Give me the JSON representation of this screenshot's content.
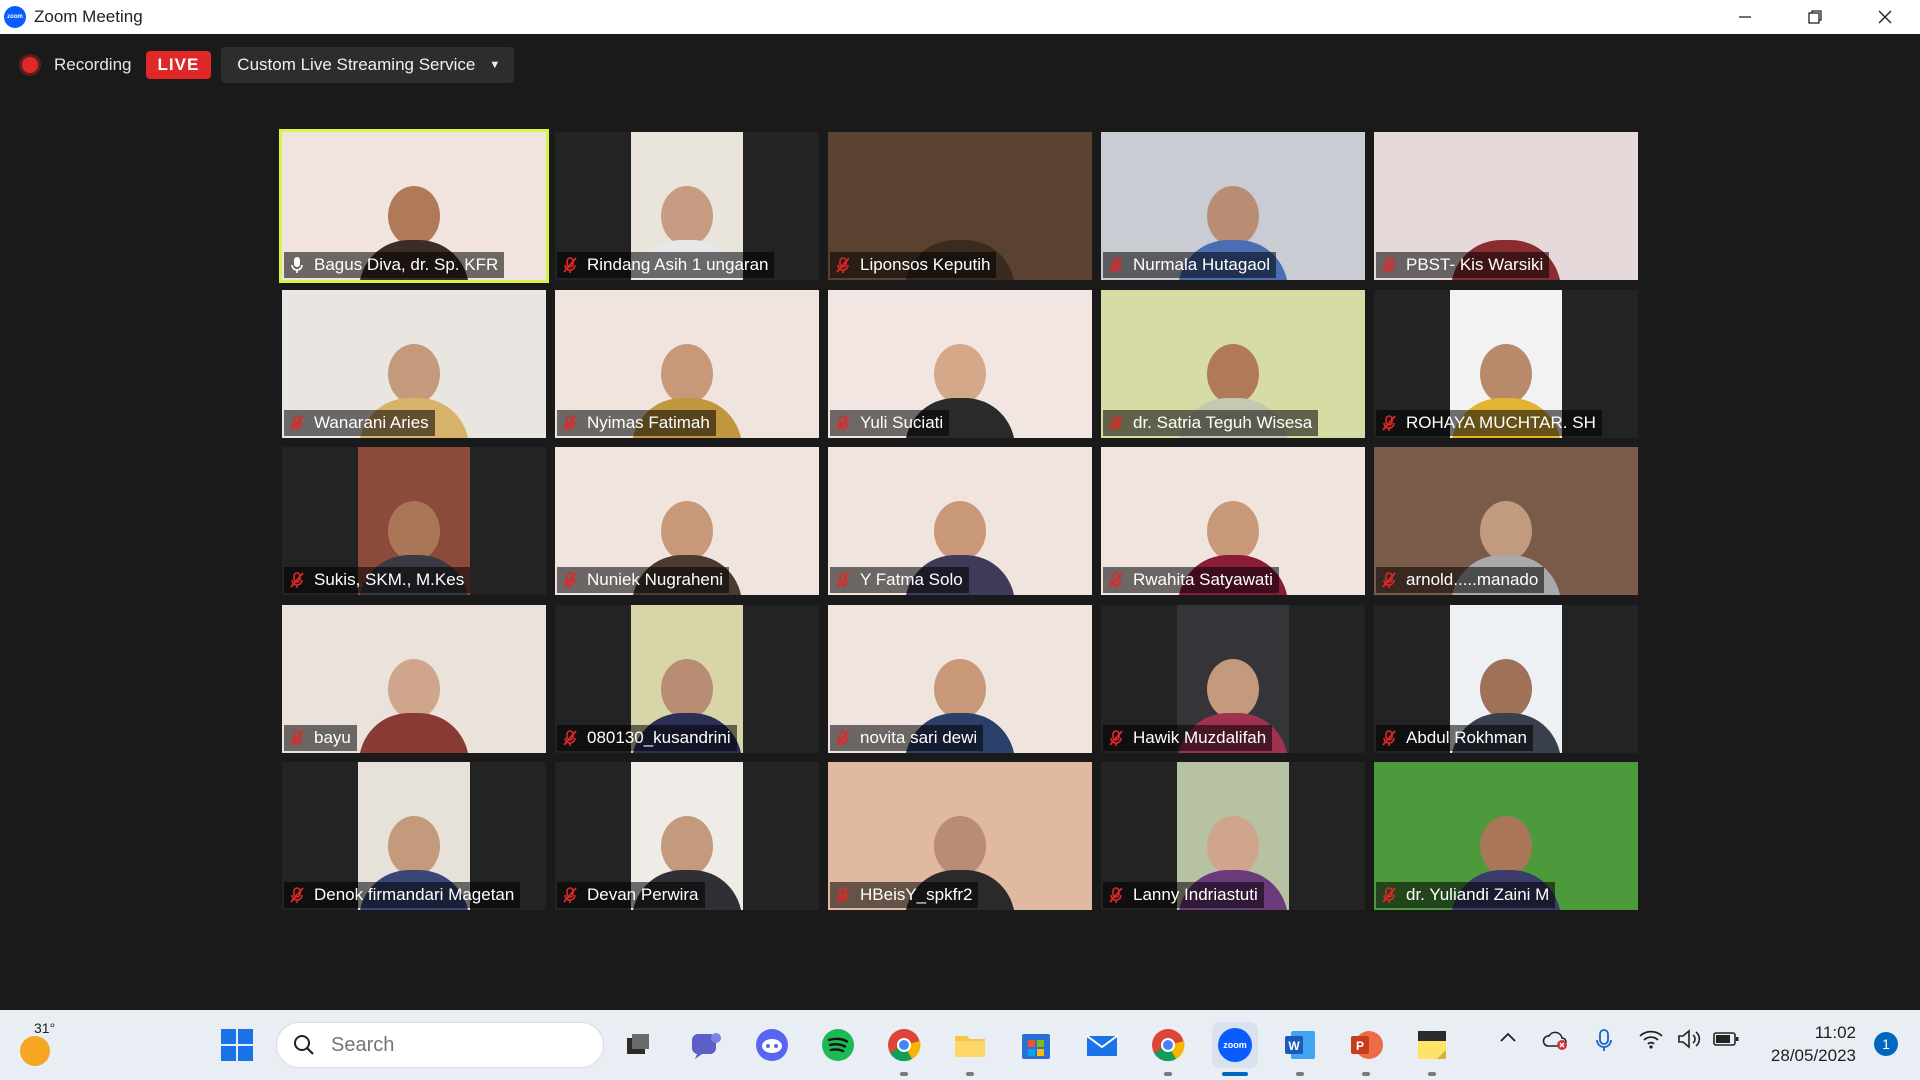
{
  "window": {
    "title": "Zoom Meeting",
    "minimize_icon": "minimize-icon",
    "restore_icon": "restore-icon",
    "close_icon": "close-icon"
  },
  "meeting_bar": {
    "recording_label": "Recording",
    "live_label": "LIVE",
    "stream_service": "Custom Live Streaming Service"
  },
  "colors": {
    "active_speaker": "#d9f34a",
    "live_red": "#e02828",
    "mic_muted": "#e02828"
  },
  "participants": [
    {
      "name": "Bagus Diva, dr. Sp. KFR",
      "mic": "active",
      "active": true,
      "layout": "full",
      "bg": "#f1e4de",
      "skin": "#b07a58",
      "cloth": "#3a2c28"
    },
    {
      "name": "Rindang Asih 1 ungaran",
      "mic": "muted",
      "layout": "narrow",
      "bg": "#e9e4dc",
      "skin": "#c69d83",
      "cloth": "#e8e8ea"
    },
    {
      "name": "Liponsos Keputih",
      "mic": "muted",
      "layout": "full",
      "bg": "#5b4230",
      "skin": "#5b4230",
      "cloth": "#3b2a1e"
    },
    {
      "name": "Nurmala Hutagaol",
      "mic": "muted",
      "layout": "full",
      "bg": "#c9ccd2",
      "skin": "#b88d73",
      "cloth": "#4a6db3"
    },
    {
      "name": "PBST- Kis Warsiki",
      "mic": "muted",
      "layout": "full",
      "bg": "#e6d9da",
      "skin": "#e6d9da",
      "cloth": "#8a2d32"
    },
    {
      "name": "Wanarani Aries",
      "mic": "muted",
      "layout": "full",
      "bg": "#e9e6e2",
      "skin": "#c49a7d",
      "cloth": "#d8b26a"
    },
    {
      "name": "Nyimas Fatimah",
      "mic": "muted",
      "layout": "full",
      "bg": "#f0e4de",
      "skin": "#c99879",
      "cloth": "#c0963e"
    },
    {
      "name": "Yuli Suciati",
      "mic": "muted",
      "layout": "full",
      "bg": "#f1e6e1",
      "skin": "#d6a88a",
      "cloth": "#2a2a2a"
    },
    {
      "name": "dr. Satria Teguh Wisesa",
      "mic": "muted",
      "layout": "full",
      "bg": "#d6dca4",
      "skin": "#b07a58",
      "cloth": "#c6c8b2"
    },
    {
      "name": "ROHAYA MUCHTAR. SH",
      "mic": "muted",
      "layout": "narrow",
      "bg": "#f2f2f2",
      "skin": "#b98a6a",
      "cloth": "#e3b433"
    },
    {
      "name": "Sukis, SKM., M.Kes",
      "mic": "muted",
      "layout": "narrow",
      "bg": "#8c4a3a",
      "skin": "#a97757",
      "cloth": "#3a3a44"
    },
    {
      "name": "Nuniek Nugraheni",
      "mic": "muted",
      "layout": "full",
      "bg": "#f0e4de",
      "skin": "#c99879",
      "cloth": "#4b3a32"
    },
    {
      "name": "Y Fatma Solo",
      "mic": "muted",
      "layout": "full",
      "bg": "#f0e4de",
      "skin": "#c99879",
      "cloth": "#3f3a5a"
    },
    {
      "name": "Rwahita Satyawati",
      "mic": "muted",
      "layout": "full",
      "bg": "#f0e4de",
      "skin": "#c99879",
      "cloth": "#8a1c3a"
    },
    {
      "name": "arnold.....manado",
      "mic": "muted",
      "layout": "full",
      "bg": "#7a5a48",
      "skin": "#c29a7e",
      "cloth": "#a9a9a9"
    },
    {
      "name": "bayu",
      "mic": "muted",
      "layout": "full",
      "bg": "#ece2dc",
      "skin": "#cfa58c",
      "cloth": "#8a3a34"
    },
    {
      "name": "080130_kusandrini",
      "mic": "muted",
      "layout": "narrow",
      "bg": "#d8d6a8",
      "skin": "#b88d73",
      "cloth": "#2b2f55"
    },
    {
      "name": "novita sari dewi",
      "mic": "muted",
      "layout": "full",
      "bg": "#f0e4de",
      "skin": "#c99879",
      "cloth": "#2a3f6a"
    },
    {
      "name": "Hawik Muzdalifah",
      "mic": "muted",
      "layout": "narrow",
      "bg": "#353539",
      "skin": "#c49a7d",
      "cloth": "#a03250"
    },
    {
      "name": "Abdul Rokhman",
      "mic": "muted",
      "layout": "narrow",
      "bg": "#eef1f4",
      "skin": "#9f7258",
      "cloth": "#3a3f4e"
    },
    {
      "name": "Denok firmandari Magetan",
      "mic": "muted",
      "layout": "narrow",
      "bg": "#e6e2da",
      "skin": "#c49a7d",
      "cloth": "#3a4678"
    },
    {
      "name": "Devan Perwira",
      "mic": "muted",
      "layout": "narrow",
      "bg": "#efece8",
      "skin": "#c49a7d",
      "cloth": "#2f2f36"
    },
    {
      "name": "HBeisY_spkfr2",
      "mic": "muted",
      "layout": "full",
      "bg": "#e1b9a0",
      "skin": "#b88d73",
      "cloth": "#2a2a2a"
    },
    {
      "name": "Lanny Indriastuti",
      "mic": "muted",
      "layout": "narrow",
      "bg": "#b7c2a2",
      "skin": "#cfa58c",
      "cloth": "#6a3a7a"
    },
    {
      "name": "dr. Yuliandi Zaini M",
      "mic": "muted",
      "layout": "full",
      "bg": "#4c9a3c",
      "skin": "#a97757",
      "cloth": "#3c3c6a"
    }
  ],
  "taskbar": {
    "weather_temp": "31°",
    "search_placeholder": "Search",
    "apps": [
      "start-icon",
      "task-view-icon",
      "teams-icon",
      "discord-icon",
      "spotify-icon",
      "chrome-icon",
      "file-explorer-icon",
      "store-icon",
      "mail-icon",
      "chrome-profile-icon",
      "zoom-icon",
      "word-icon",
      "powerpoint-icon",
      "sticky-notes-icon"
    ],
    "tray": [
      "chevron-up-icon",
      "onedrive-error-icon",
      "microphone-icon",
      "wifi-icon",
      "volume-icon",
      "battery-icon"
    ],
    "time": "11:02",
    "date": "28/05/2023",
    "notification_count": "1"
  }
}
